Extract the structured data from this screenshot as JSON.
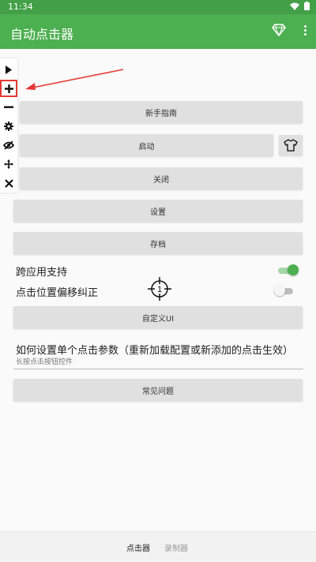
{
  "statusbar": {
    "time": "11:34"
  },
  "appbar": {
    "title": "自动点击器"
  },
  "buttons": {
    "guide": "新手指南",
    "start": "启动",
    "stop": "关闭",
    "settings": "设置",
    "archive": "存档",
    "custom_ui": "自定义UI",
    "faq": "常见问题"
  },
  "options": {
    "cross_app": {
      "label": "跨应用支持",
      "on": true
    },
    "offset_fix": {
      "label": "点击位置偏移纠正",
      "on": false
    }
  },
  "help": {
    "title": "如何设置单个点击参数（重新加载配置或新添加的点击生效）",
    "subtitle": "长按点击按钮控件"
  },
  "bottom_nav": {
    "clicker": "点击器",
    "recorder": "录制器"
  },
  "colors": {
    "primary": "#4caf50",
    "status": "#43a047",
    "highlight": "#e53935"
  },
  "icons": [
    "play-icon",
    "plus-icon",
    "minus-icon",
    "gear-icon",
    "eye-off-icon",
    "move-icon",
    "close-icon",
    "shirt-icon",
    "gem-icon",
    "crosshair-icon"
  ]
}
